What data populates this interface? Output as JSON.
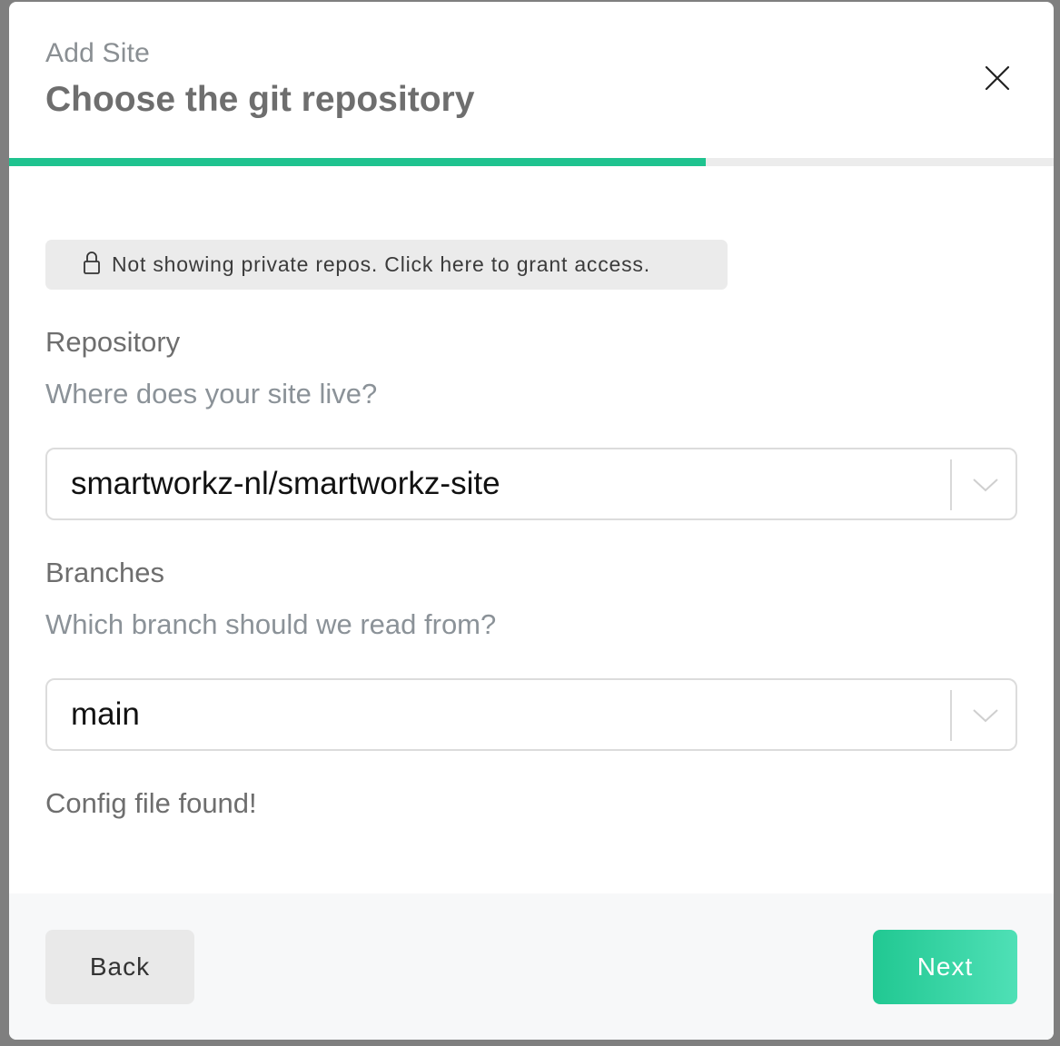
{
  "modal": {
    "kicker": "Add Site",
    "title": "Choose the git repository",
    "close_icon": "close-icon",
    "progress_fraction": 0.667
  },
  "notice": {
    "icon": "lock-icon",
    "text": "Not showing private repos. Click here to grant access."
  },
  "repository": {
    "label": "Repository",
    "description": "Where does your site live?",
    "selected": "smartworkz-nl/smartworkz-site",
    "icon": "chevron-down-icon"
  },
  "branches": {
    "label": "Branches",
    "description": "Which branch should we read from?",
    "selected": "main",
    "icon": "chevron-down-icon"
  },
  "status": "Config file found!",
  "footer": {
    "back_label": "Back",
    "next_label": "Next"
  },
  "colors": {
    "accent": "#1fc38f",
    "accent_light": "#4fe0b6",
    "backdrop": "#7f7f7f"
  }
}
